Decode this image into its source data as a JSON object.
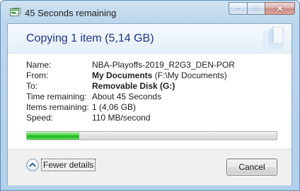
{
  "window": {
    "title": "45 Seconds remaining",
    "caption_buttons": [
      {
        "name": "minimize",
        "glyph": "–"
      },
      {
        "name": "maximize",
        "glyph": "□"
      },
      {
        "name": "close",
        "glyph": "✕"
      }
    ]
  },
  "header": {
    "main_instruction": "Copying 1 item (5,14 GB)"
  },
  "details": {
    "name_label": "Name:",
    "name_value": "NBA-Playoffs-2019_R2G3_DEN-POR",
    "from_label": "From:",
    "from_bold": "My Documents",
    "from_rest": " (F:\\My Documents)",
    "to_label": "To:",
    "to_bold": "Removable Disk (G:)",
    "time_label": "Time remaining:",
    "time_value": "About 45 Seconds",
    "items_label": "Items remaining:",
    "items_value": "1 (4,06 GB)",
    "speed_label": "Speed:",
    "speed_value": "110 MB/second"
  },
  "progress": {
    "percent": 21,
    "color": "#2fc42b"
  },
  "footer": {
    "fewer_details_label": "Fewer details",
    "cancel_label": "Cancel"
  },
  "colors": {
    "main_instruction": "#1e3287",
    "frame": "#b9d4ea",
    "close_button": "#c98b82"
  },
  "icons": {
    "title_icon": "copy-progress-icon",
    "chevron": "chevron-up-icon",
    "header_art": "copy-animation-icon"
  }
}
